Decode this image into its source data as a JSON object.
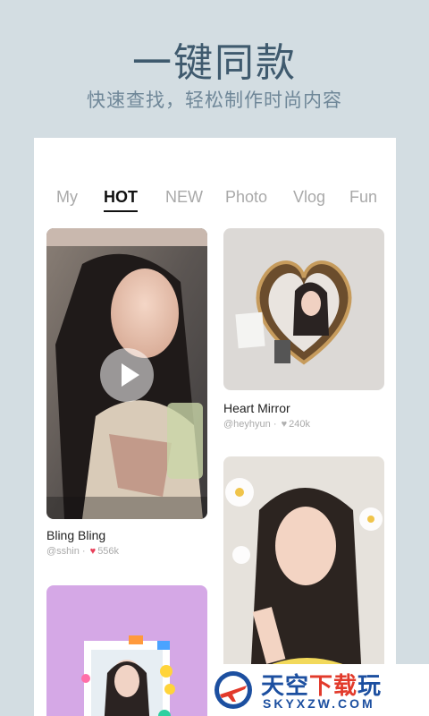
{
  "hero": {
    "title": "一键同款",
    "subtitle": "快速查找，轻松制作时尚内容"
  },
  "tabs": [
    {
      "label": "My",
      "active": false
    },
    {
      "label": "HOT",
      "active": true
    },
    {
      "label": "NEW",
      "active": false
    },
    {
      "label": "Photo",
      "active": false
    },
    {
      "label": "Vlog",
      "active": false
    },
    {
      "label": "Fun",
      "active": false
    }
  ],
  "cards": [
    {
      "title": "Bling Bling",
      "author": "@sshin",
      "likes": "556k",
      "liked": true,
      "type": "video"
    },
    {
      "title": "Heart Mirror",
      "author": "@heyhyun",
      "likes": "240k",
      "liked": false,
      "type": "photo"
    },
    {
      "title": "",
      "author": "",
      "likes": "",
      "type": "photo"
    },
    {
      "title": "",
      "author": "",
      "likes": "",
      "type": "photo"
    }
  ],
  "watermark": {
    "main_blue": "天空",
    "main_red": "下载",
    "main_blue2": "玩",
    "sub": "SKYXZW.COM"
  },
  "colors": {
    "background": "#d3dde2",
    "title_color": "#3f5a6e",
    "liked_heart": "#e8405a",
    "unliked_heart": "#b0b0b0",
    "brand_blue": "#1c4fa0",
    "brand_red": "#e23a2b"
  }
}
